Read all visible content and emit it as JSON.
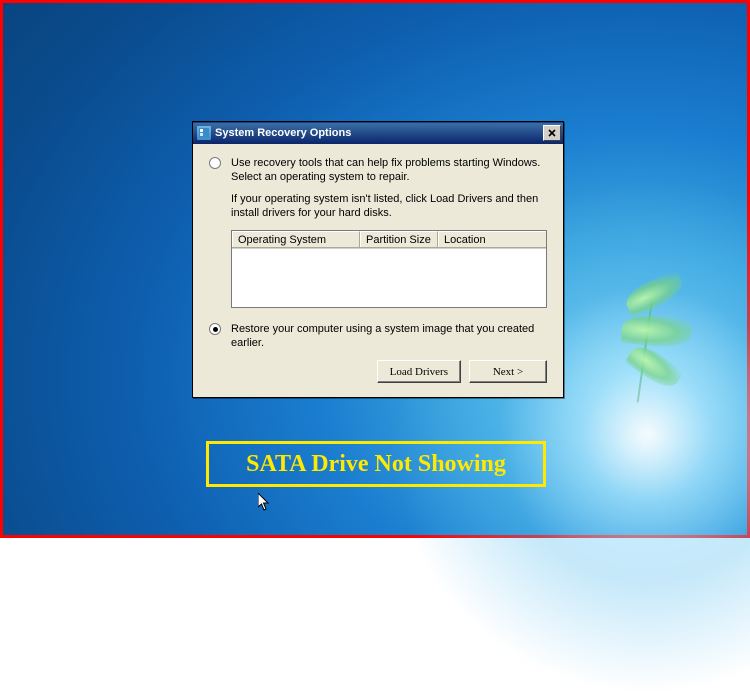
{
  "dialog": {
    "title": "System Recovery Options",
    "option1": {
      "selected": false,
      "text": "Use recovery tools that can help fix problems starting Windows. Select an operating system to repair.",
      "hint": "If your operating system isn't listed, click Load Drivers and then install drivers for your hard disks."
    },
    "option2": {
      "selected": true,
      "text": "Restore your computer using a system image that you created earlier."
    },
    "columns": {
      "os": "Operating System",
      "size": "Partition Size",
      "location": "Location"
    },
    "buttons": {
      "load": "Load Drivers",
      "next": "Next >"
    }
  },
  "annotation": "SATA Drive Not Showing"
}
